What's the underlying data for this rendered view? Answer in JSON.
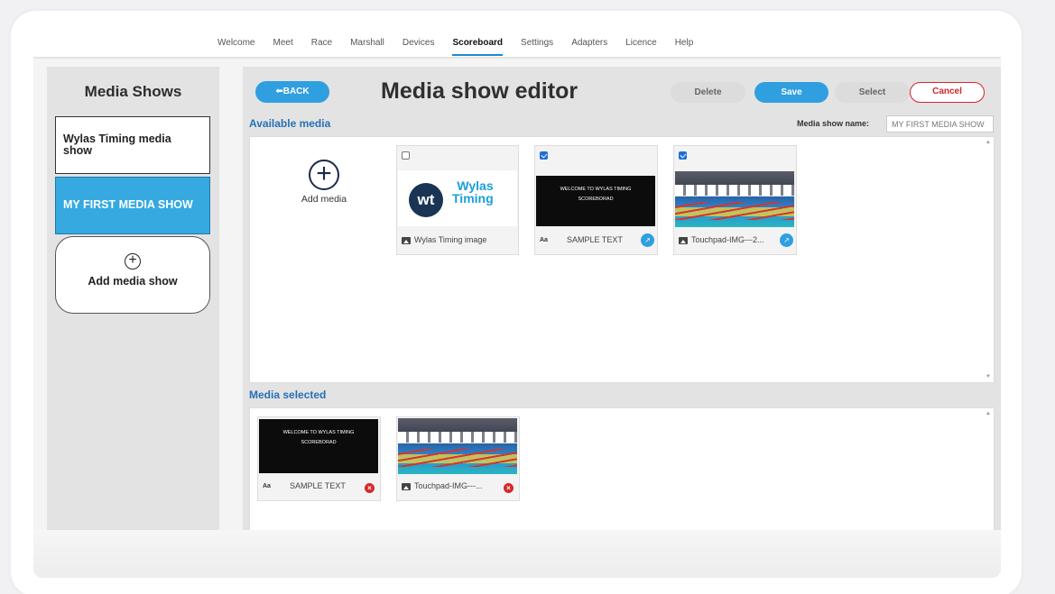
{
  "nav": {
    "items": [
      "Welcome",
      "Meet",
      "Race",
      "Marshall",
      "Devices",
      "Scoreboard",
      "Settings",
      "Adapters",
      "Licence",
      "Help"
    ],
    "active": "Scoreboard"
  },
  "sidebar": {
    "title": "Media Shows",
    "shows": [
      {
        "label": "Wylas Timing media show",
        "selected": false
      },
      {
        "label": "MY FIRST MEDIA SHOW",
        "selected": true
      }
    ],
    "add_label": "Add media show"
  },
  "editor": {
    "back_label": "⬅BACK",
    "title": "Media show editor",
    "delete_label": "Delete",
    "save_label": "Save",
    "select_label": "Select",
    "cancel_label": "Cancel",
    "available_label": "Available media",
    "name_label": "Media show name:",
    "name_value": "MY FIRST MEDIA SHOW",
    "selected_label": "Media selected",
    "add_media_label": "Add media"
  },
  "available_media": [
    {
      "caption": "Wylas Timing image",
      "checked": false,
      "type": "image"
    },
    {
      "caption": "SAMPLE TEXT",
      "checked": true,
      "type": "text",
      "screen_text": [
        "WELCOME TO WYLAS TIMING",
        "SCOREBORAD"
      ]
    },
    {
      "caption": "Touchpad-IMG---2...",
      "checked": true,
      "type": "image"
    }
  ],
  "logo": {
    "initials": "wt",
    "line1": "Wylas",
    "line2": "Timing"
  },
  "selected_media": [
    {
      "caption": "SAMPLE TEXT",
      "type": "text",
      "screen_text": [
        "WELCOME TO WYLAS TIMING",
        "SCOREBORAD"
      ]
    },
    {
      "caption": "Touchpad-IMG---...",
      "type": "image"
    }
  ],
  "colors": {
    "accent": "#2f9fe0",
    "selected_show": "#35a9e0",
    "cancel": "#d0262c",
    "section_label": "#2570b5"
  }
}
